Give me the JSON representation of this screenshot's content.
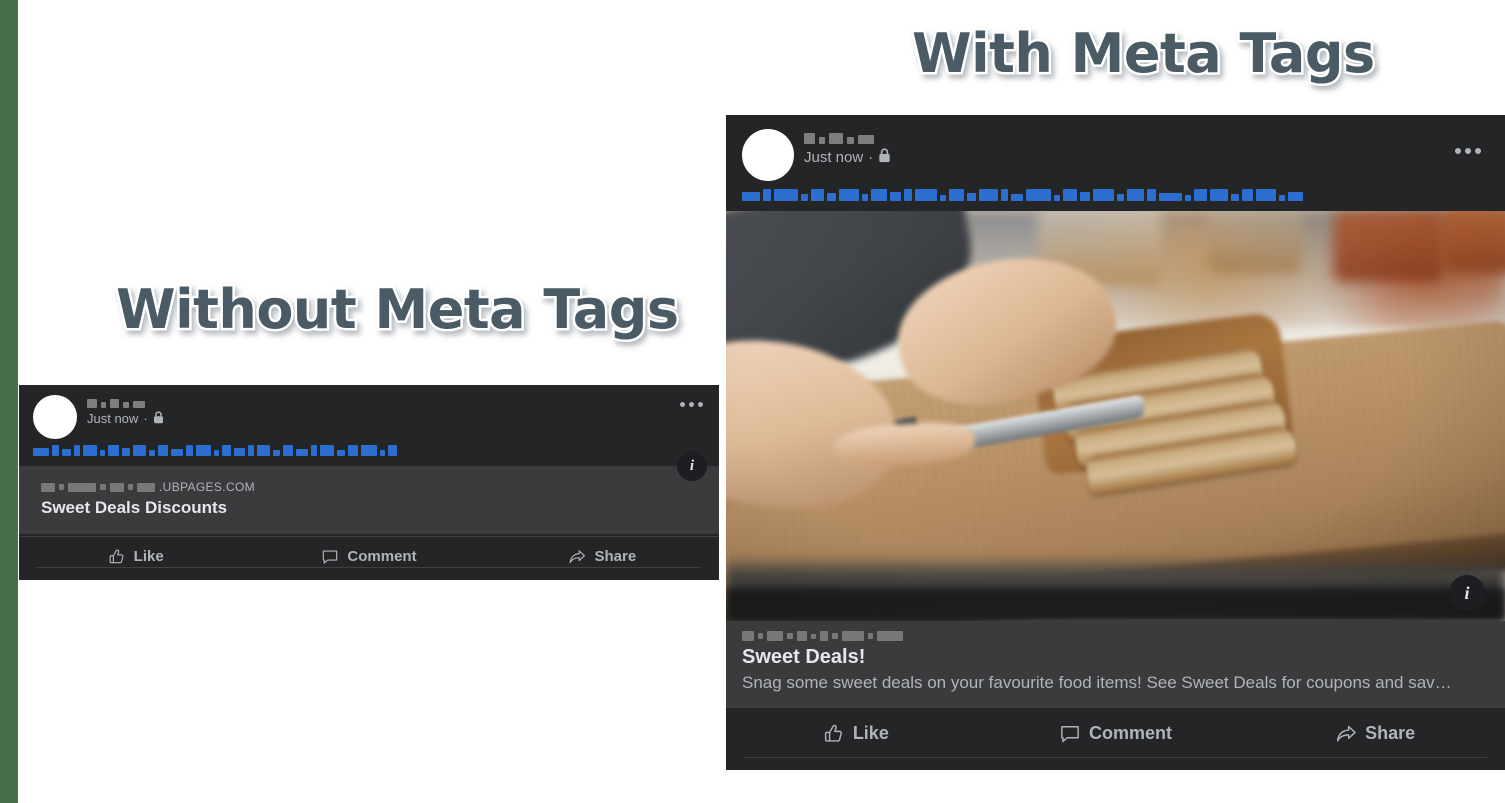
{
  "page": {
    "background_color": "#ffffff",
    "edge_strip_color": "#47704a"
  },
  "headings": {
    "left": "Without Meta Tags",
    "right": "With Meta Tags",
    "color": "#4a5b66",
    "outline_color": "#ffffff"
  },
  "cards": [
    {
      "id": "without-meta-tags",
      "header": {
        "author_name_redacted": true,
        "timestamp": "Just now",
        "separator": "·",
        "privacy_icon": "lock-icon",
        "menu_icon": "more-options-icon"
      },
      "post_text_redacted": true,
      "link_preview": {
        "domain_visible_suffix": ".UBPAGES.COM",
        "domain_redacted_prefix": true,
        "title": "Sweet Deals Discounts",
        "description": "",
        "has_image": false,
        "info_badge": "i"
      },
      "actions": [
        {
          "label": "Like",
          "icon": "thumbs-up-icon"
        },
        {
          "label": "Comment",
          "icon": "comment-bubble-icon"
        },
        {
          "label": "Share",
          "icon": "share-arrow-icon"
        }
      ]
    },
    {
      "id": "with-meta-tags",
      "header": {
        "author_name_redacted": true,
        "timestamp": "Just now",
        "separator": "·",
        "privacy_icon": "lock-icon",
        "menu_icon": "more-options-icon"
      },
      "post_text_redacted": true,
      "link_preview": {
        "domain_visible_suffix": "",
        "domain_redacted_prefix": true,
        "title": "Sweet Deals!",
        "description": "Snag some sweet deals on your favourite food items! See Sweet Deals for coupons and sav…",
        "has_image": true,
        "image_alt": "Hands slicing a loaf of bread with a knife on a wooden cutting board",
        "info_badge": "i"
      },
      "actions": [
        {
          "label": "Like",
          "icon": "thumbs-up-icon"
        },
        {
          "label": "Comment",
          "icon": "comment-bubble-icon"
        },
        {
          "label": "Share",
          "icon": "share-arrow-icon"
        }
      ]
    }
  ],
  "colors": {
    "card_background": "#242526",
    "link_preview_background": "#3a3b3c",
    "primary_text": "#e4e6eb",
    "secondary_text": "#b0b3b8",
    "divider": "#3e4042",
    "redacted_blue": "#2c6fd1",
    "redacted_gray": "#9a9c9e",
    "info_badge_background": "#1c1e21"
  }
}
